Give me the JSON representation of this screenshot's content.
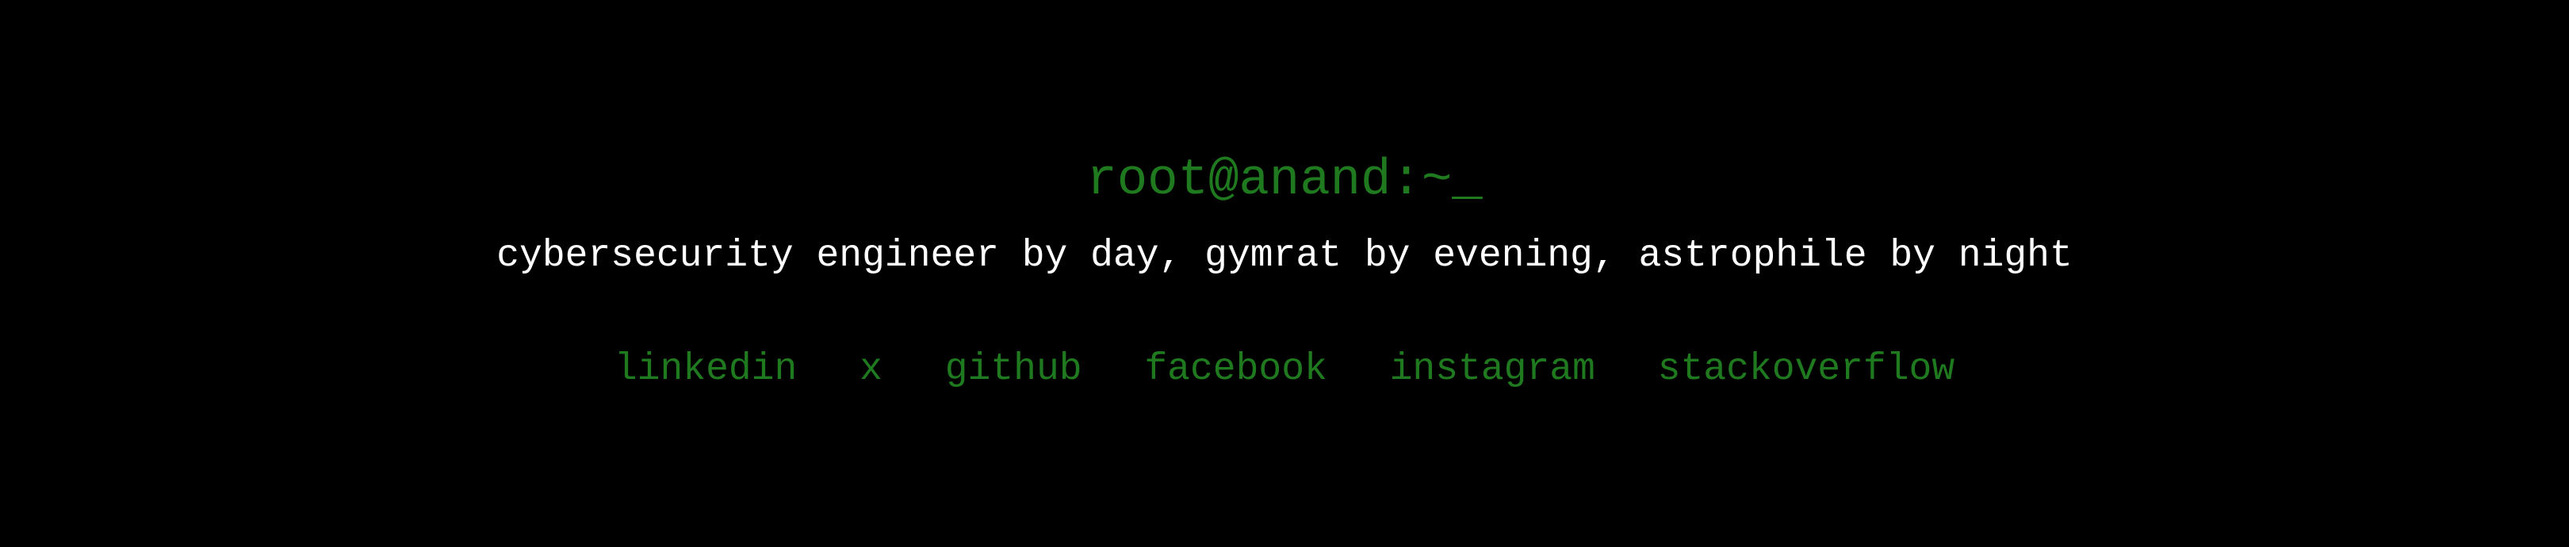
{
  "header": {
    "prompt": "root@anand:~_",
    "tagline": "cybersecurity engineer by day, gymrat by evening, astrophile by night"
  },
  "social_links": [
    {
      "label": "linkedin"
    },
    {
      "label": "x"
    },
    {
      "label": "github"
    },
    {
      "label": "facebook"
    },
    {
      "label": "instagram"
    },
    {
      "label": "stackoverflow"
    }
  ],
  "colors": {
    "background": "#000000",
    "accent_green": "#1f7a1f",
    "text_white": "#ffffff"
  }
}
